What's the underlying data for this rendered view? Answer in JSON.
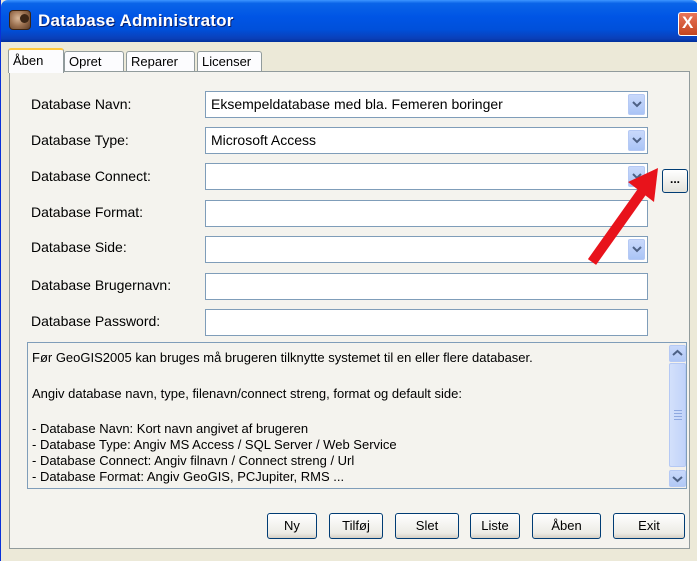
{
  "window": {
    "title": "Database Administrator",
    "close_label": "X"
  },
  "tabs": [
    {
      "label": "Åben",
      "active": true
    },
    {
      "label": "Opret",
      "active": false
    },
    {
      "label": "Reparer",
      "active": false
    },
    {
      "label": "Licenser",
      "active": false
    }
  ],
  "form": {
    "name_label": "Database Navn:",
    "name_value": "Eksempeldatabase med bla. Femeren boringer",
    "type_label": "Database Type:",
    "type_value": "Microsoft Access",
    "connect_label": "Database Connect:",
    "connect_value": "",
    "browse_label": "...",
    "format_label": "Database Format:",
    "format_value": "",
    "side_label": "Database Side:",
    "side_value": "",
    "user_label": "Database Brugernavn:",
    "user_value": "",
    "password_label": "Database Password:",
    "password_value": ""
  },
  "info": {
    "lines": [
      "Før GeoGIS2005 kan bruges må brugeren tilknytte systemet til en eller flere databaser.",
      "Angiv database navn, type, filenavn/connect streng, format og default side:",
      "- Database Navn: Kort navn angivet af brugeren",
      "- Database Type: Angiv MS Access / SQL Server / Web Service",
      "- Database Connect: Angiv filnavn / Connect streng / Url",
      "- Database Format: Angiv GeoGIS, PCJupiter, RMS ..."
    ]
  },
  "buttons": {
    "new": "Ny",
    "add": "Tilføj",
    "delete": "Slet",
    "list": "Liste",
    "open": "Åben",
    "exit": "Exit"
  },
  "colors": {
    "titlebar": "#0055e5",
    "annotation_arrow": "#e8131b",
    "tab_highlight": "#ffc83c"
  }
}
